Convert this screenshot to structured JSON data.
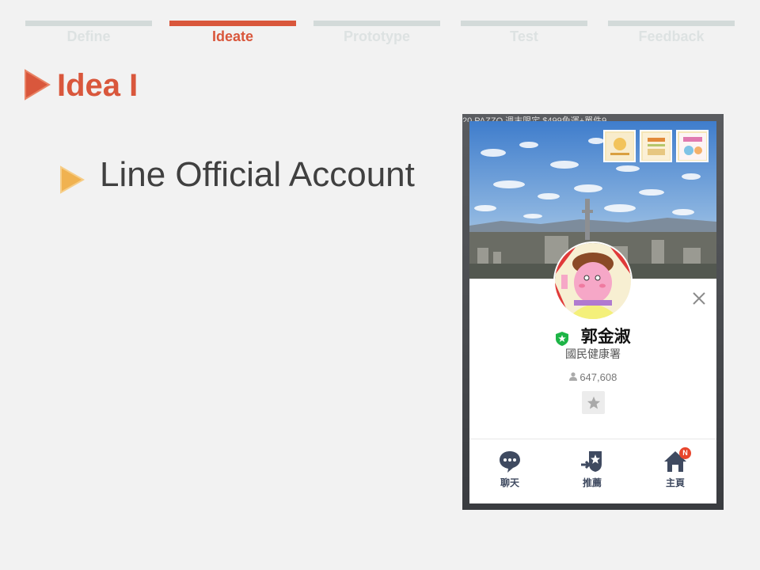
{
  "steps": [
    {
      "label": "Define",
      "active": false
    },
    {
      "label": "Ideate",
      "active": true
    },
    {
      "label": "Prototype",
      "active": false
    },
    {
      "label": "Test",
      "active": false
    },
    {
      "label": "Feedback",
      "active": false
    }
  ],
  "title": "Idea I",
  "bullet": "Line Official Account",
  "phone": {
    "topbar_text": "20 PAZZO   週末限定 $499免運+單件9",
    "profile": {
      "name": "郭金淑",
      "subtitle": "國民健康署",
      "friends": "647,608"
    },
    "nav": [
      {
        "label": "聊天",
        "icon": "chat-bubble-icon"
      },
      {
        "label": "推薦",
        "icon": "recommend-icon"
      },
      {
        "label": "主頁",
        "icon": "home-icon",
        "badge": "N"
      }
    ]
  },
  "colors": {
    "accent": "#d9573c",
    "bullet": "#f0b250",
    "inactive_tab": "#d3dad9",
    "nav_icon": "#3f4a60",
    "line_green": "#1db446"
  }
}
